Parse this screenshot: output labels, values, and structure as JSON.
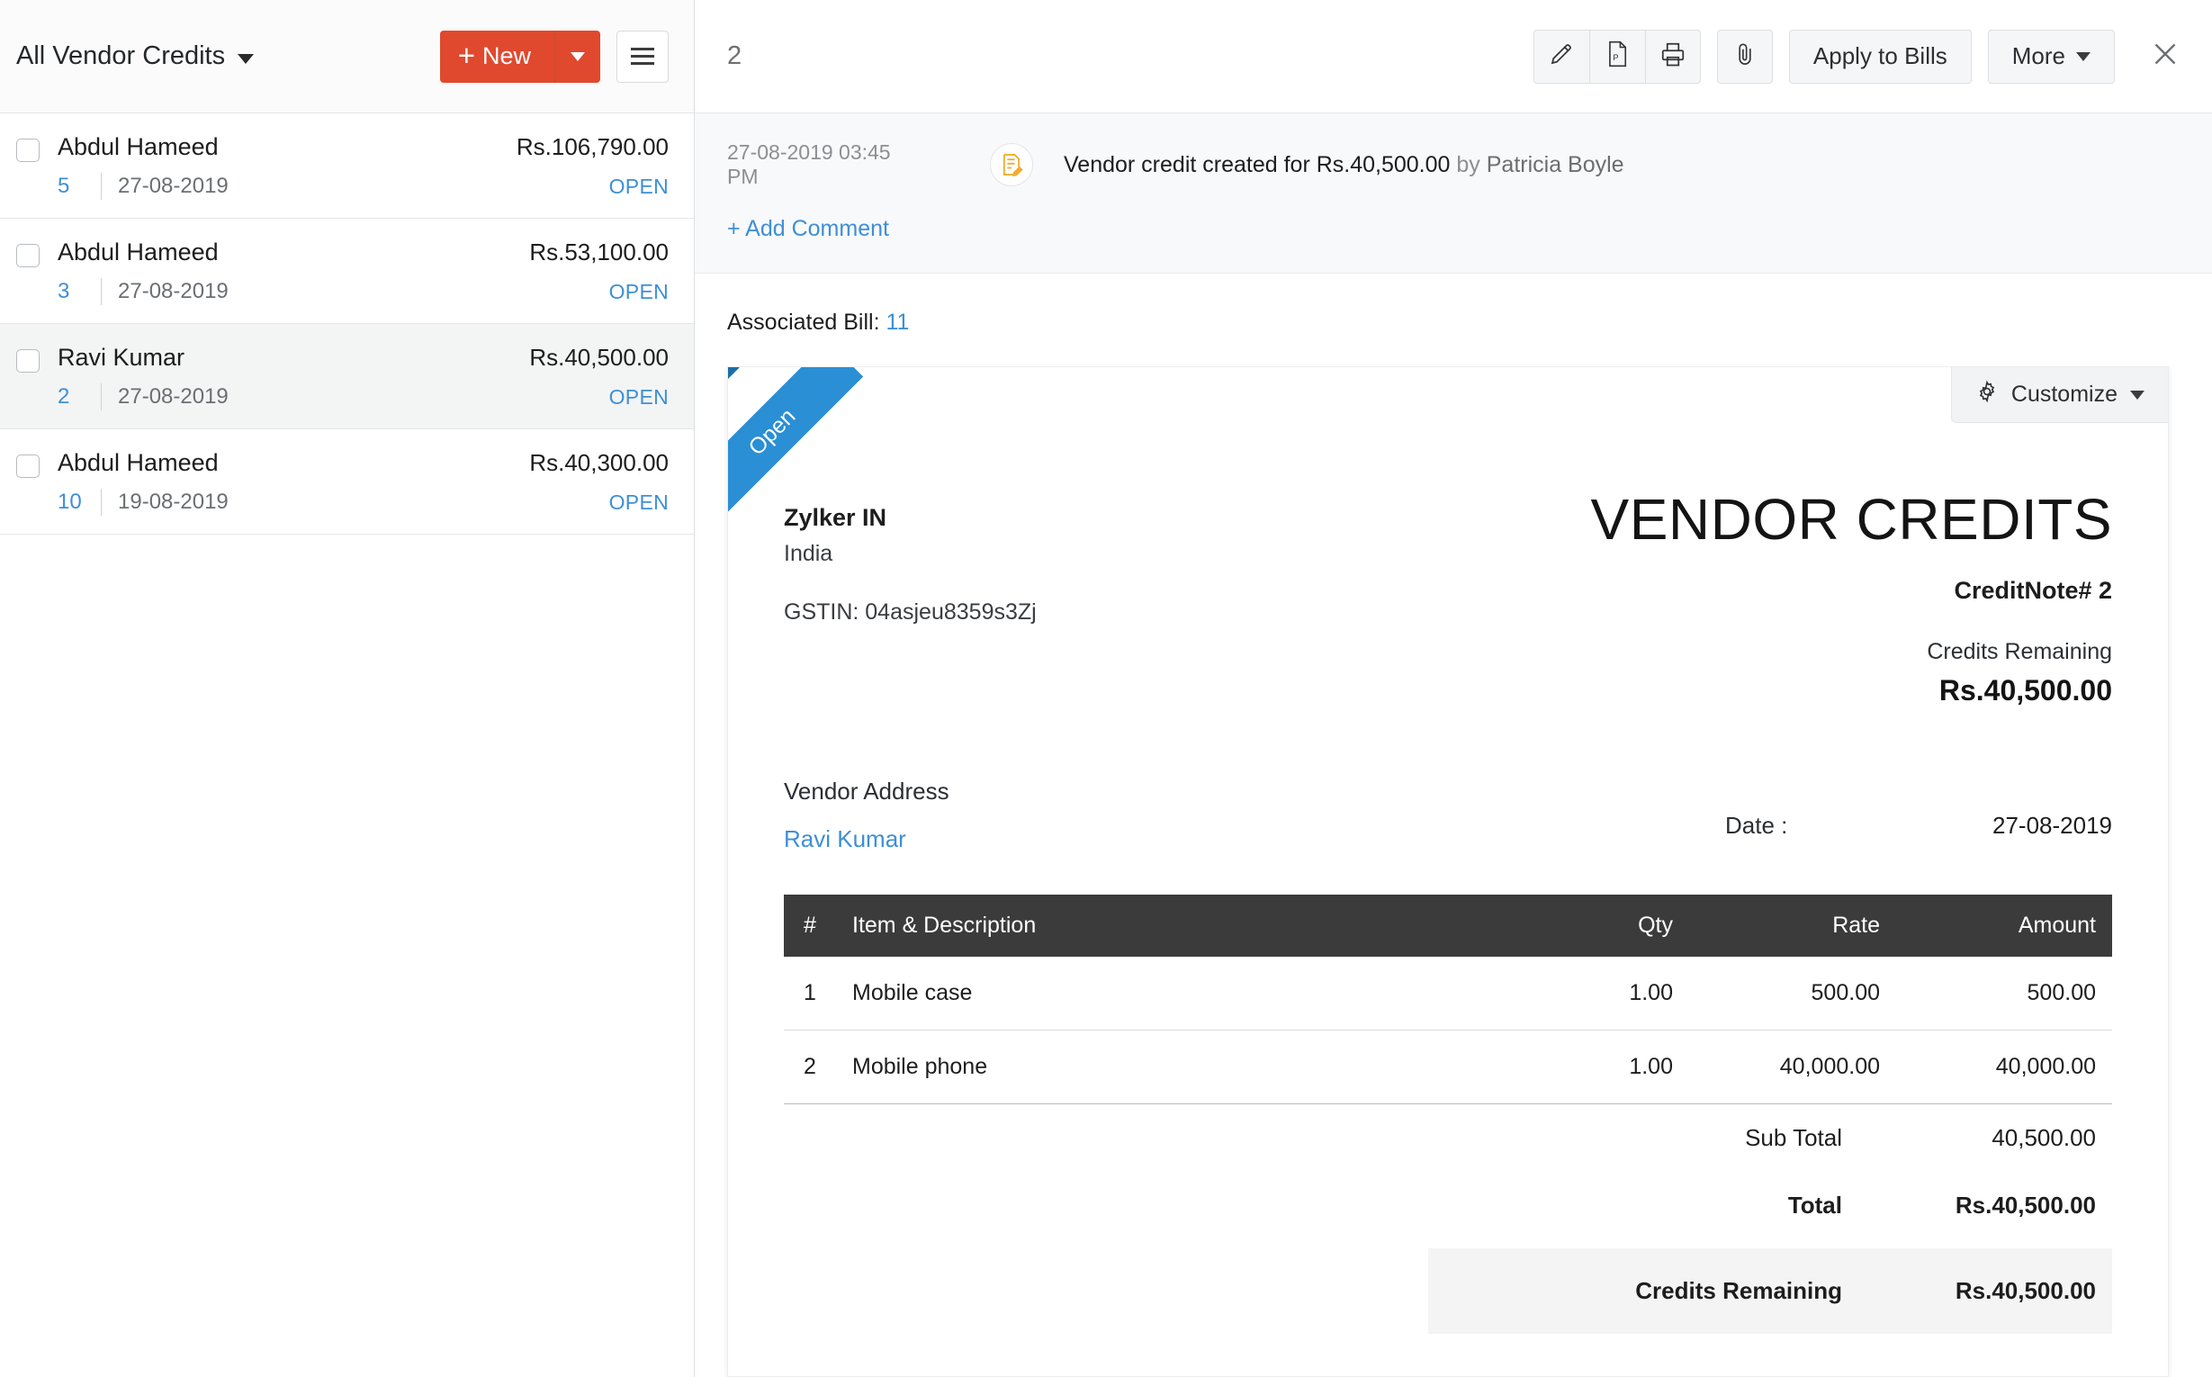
{
  "left": {
    "title": "All Vendor Credits",
    "new_label": "New",
    "items": [
      {
        "name": "Abdul Hameed",
        "amount": "Rs.106,790.00",
        "number": "5",
        "date": "27-08-2019",
        "status": "OPEN",
        "selected": false
      },
      {
        "name": "Abdul Hameed",
        "amount": "Rs.53,100.00",
        "number": "3",
        "date": "27-08-2019",
        "status": "OPEN",
        "selected": false
      },
      {
        "name": "Ravi Kumar",
        "amount": "Rs.40,500.00",
        "number": "2",
        "date": "27-08-2019",
        "status": "OPEN",
        "selected": true
      },
      {
        "name": "Abdul Hameed",
        "amount": "Rs.40,300.00",
        "number": "10",
        "date": "19-08-2019",
        "status": "OPEN",
        "selected": false
      }
    ]
  },
  "detail": {
    "record_number": "2",
    "toolbar": {
      "apply_to_bills": "Apply to Bills",
      "more": "More"
    },
    "activity": {
      "timestamp": "27-08-2019 03:45 PM",
      "text_main": "Vendor credit created for Rs.40,500.00",
      "text_by": " by ",
      "person": "Patricia Boyle",
      "add_comment": "+ Add Comment"
    },
    "associated_bill_label": "Associated Bill: ",
    "associated_bill_value": "11"
  },
  "document": {
    "ribbon": "Open",
    "customize": "Customize",
    "org_name": "Zylker IN",
    "org_country": "India",
    "gstin": "GSTIN: 04asjeu8359s3Zj",
    "title": "VENDOR CREDITS",
    "creditnote": "CreditNote# 2",
    "credits_remaining_label": "Credits Remaining",
    "credits_remaining_value": "Rs.40,500.00",
    "vendor_address_label": "Vendor Address",
    "vendor_name": "Ravi Kumar",
    "date_label": "Date :",
    "date_value": "27-08-2019",
    "table": {
      "headers": [
        "#",
        "Item & Description",
        "Qty",
        "Rate",
        "Amount"
      ],
      "rows": [
        {
          "idx": "1",
          "item": "Mobile case",
          "qty": "1.00",
          "rate": "500.00",
          "amount": "500.00"
        },
        {
          "idx": "2",
          "item": "Mobile phone",
          "qty": "1.00",
          "rate": "40,000.00",
          "amount": "40,000.00"
        }
      ]
    },
    "totals": [
      {
        "label": "Sub Total",
        "value": "40,500.00",
        "style": "plain"
      },
      {
        "label": "Total",
        "value": "Rs.40,500.00",
        "style": "bold"
      },
      {
        "label": "Credits Remaining",
        "value": "Rs.40,500.00",
        "style": "highlight"
      }
    ]
  },
  "colors": {
    "accent_red": "#e0492e",
    "link_blue": "#3e8fd6",
    "ribbon_blue": "#2a8fd4",
    "table_header": "#3b3b3b"
  }
}
